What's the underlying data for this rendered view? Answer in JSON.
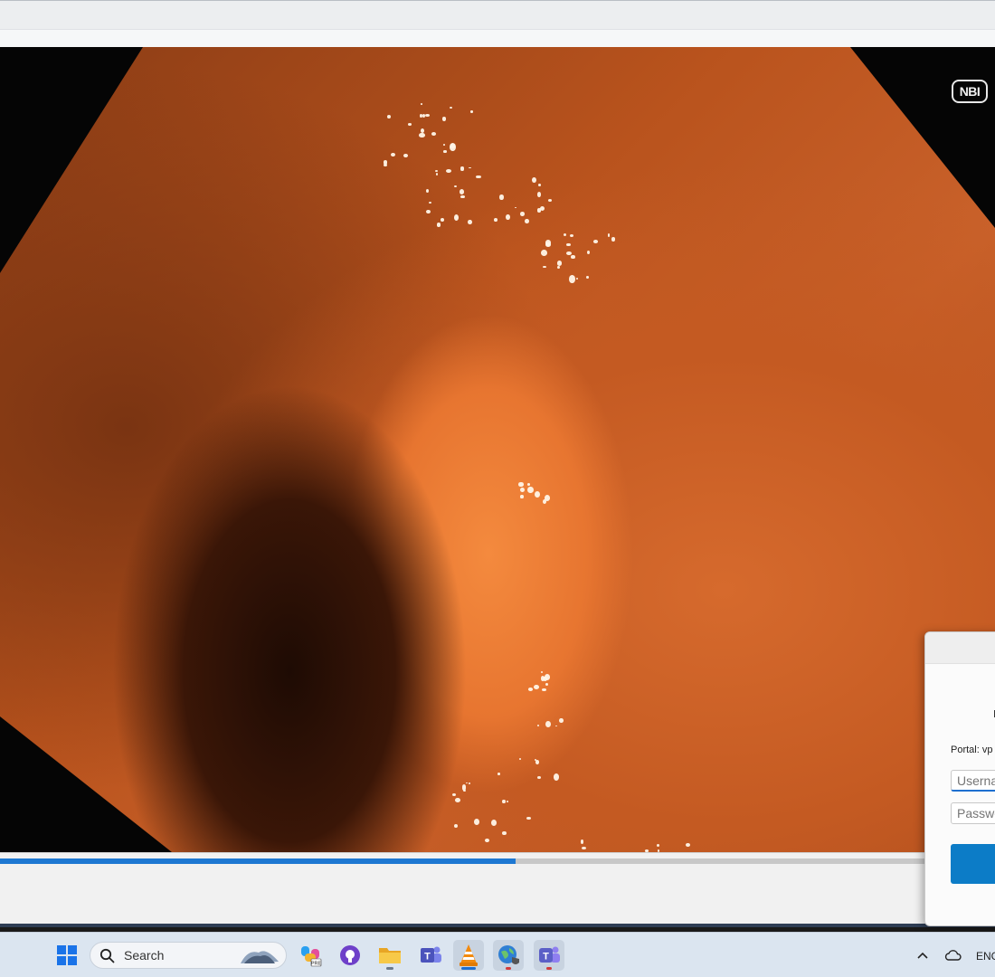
{
  "overlay": {
    "nbi_label": "NBI"
  },
  "playback": {
    "progress_percent": 51.8
  },
  "login_dialog": {
    "portal_label": "Portal: vp",
    "username_placeholder": "Userna",
    "password_placeholder": "Passwo"
  },
  "taskbar": {
    "search_label": "Search",
    "language": "ENG",
    "pinned": [
      {
        "name": "copilot-icon"
      },
      {
        "name": "github-icon"
      },
      {
        "name": "file-explorer-icon"
      },
      {
        "name": "teams-icon"
      },
      {
        "name": "vlc-icon"
      },
      {
        "name": "vpn-client-icon"
      },
      {
        "name": "teams-new-icon"
      }
    ]
  },
  "colors": {
    "accent": "#1e78d2",
    "dialog_button": "#0c7cc7",
    "taskbar_bg": "#dbe5f0"
  }
}
